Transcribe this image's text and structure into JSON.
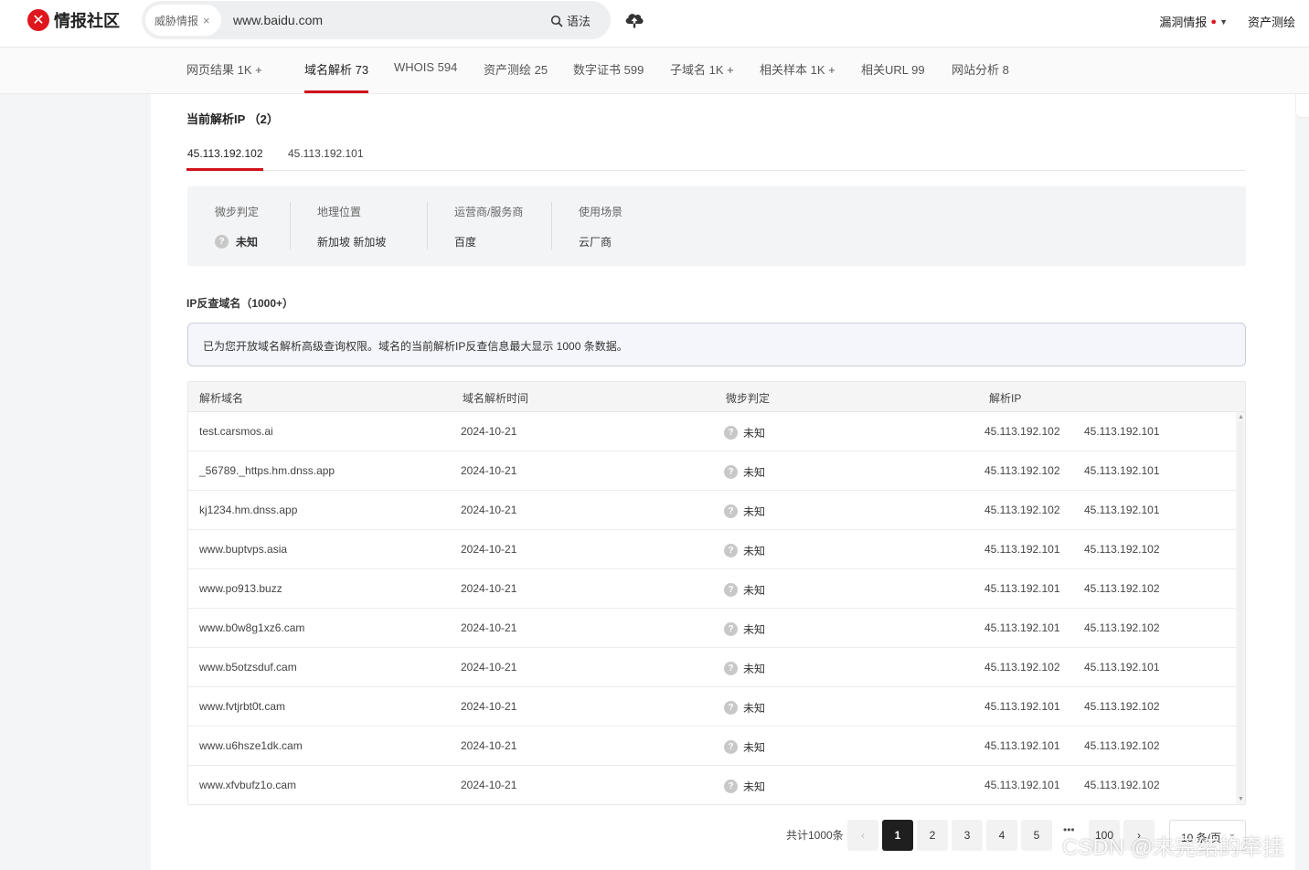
{
  "header": {
    "logo_text": "情报社区",
    "search_tag": "威胁情报",
    "search_value": "www.baidu.com",
    "syntax_label": "语法",
    "nav_vuln": "漏洞情报",
    "nav_asset": "资产测绘"
  },
  "tabs": [
    {
      "label": "网页结果 1K +"
    },
    {
      "label": "域名解析 73"
    },
    {
      "label": "WHOIS 594"
    },
    {
      "label": "资产测绘 25"
    },
    {
      "label": "数字证书 599"
    },
    {
      "label": "子域名 1K +"
    },
    {
      "label": "相关样本 1K +"
    },
    {
      "label": "相关URL 99"
    },
    {
      "label": "网站分析 8"
    }
  ],
  "current_ip": {
    "title": "当前解析IP （2）",
    "ip_tabs": [
      "45.113.192.102",
      "45.113.192.101"
    ],
    "info": {
      "judge_label": "微步判定",
      "judge_value": "未知",
      "geo_label": "地理位置",
      "geo_value": "新加坡 新加坡",
      "isp_label": "运营商/服务商",
      "isp_value": "百度",
      "scene_label": "使用场景",
      "scene_value": "云厂商"
    }
  },
  "reverse": {
    "title": "IP反查域名（1000+）",
    "notice": "已为您开放域名解析高级查询权限。域名的当前解析IP反查信息最大显示 1000 条数据。",
    "columns": [
      "解析域名",
      "域名解析时间",
      "微步判定",
      "解析IP"
    ],
    "rows": [
      {
        "domain": "test.carsmos.ai",
        "time": "2024-10-21",
        "judge": "未知",
        "ip1": "45.113.192.102",
        "ip2": "45.113.192.101"
      },
      {
        "domain": "_56789._https.hm.dnss.app",
        "time": "2024-10-21",
        "judge": "未知",
        "ip1": "45.113.192.102",
        "ip2": "45.113.192.101"
      },
      {
        "domain": "kj1234.hm.dnss.app",
        "time": "2024-10-21",
        "judge": "未知",
        "ip1": "45.113.192.102",
        "ip2": "45.113.192.101"
      },
      {
        "domain": "www.buptvps.asia",
        "time": "2024-10-21",
        "judge": "未知",
        "ip1": "45.113.192.101",
        "ip2": "45.113.192.102"
      },
      {
        "domain": "www.po913.buzz",
        "time": "2024-10-21",
        "judge": "未知",
        "ip1": "45.113.192.101",
        "ip2": "45.113.192.102"
      },
      {
        "domain": "www.b0w8g1xz6.cam",
        "time": "2024-10-21",
        "judge": "未知",
        "ip1": "45.113.192.101",
        "ip2": "45.113.192.102"
      },
      {
        "domain": "www.b5otzsduf.cam",
        "time": "2024-10-21",
        "judge": "未知",
        "ip1": "45.113.192.102",
        "ip2": "45.113.192.101"
      },
      {
        "domain": "www.fvtjrbt0t.cam",
        "time": "2024-10-21",
        "judge": "未知",
        "ip1": "45.113.192.101",
        "ip2": "45.113.192.102"
      },
      {
        "domain": "www.u6hsze1dk.cam",
        "time": "2024-10-21",
        "judge": "未知",
        "ip1": "45.113.192.101",
        "ip2": "45.113.192.102"
      },
      {
        "domain": "www.xfvbufz1o.cam",
        "time": "2024-10-21",
        "judge": "未知",
        "ip1": "45.113.192.101",
        "ip2": "45.113.192.102"
      }
    ]
  },
  "pagination": {
    "total": "共计1000条",
    "pages": [
      "1",
      "2",
      "3",
      "4",
      "5"
    ],
    "ellipsis": "•••",
    "last_page": "100",
    "page_size": "10 条/页"
  },
  "watermark": "CSDN @未完结的牵挂",
  "colors": {
    "brand_red": "#d0121b",
    "active_page": "#1f1f1f"
  }
}
